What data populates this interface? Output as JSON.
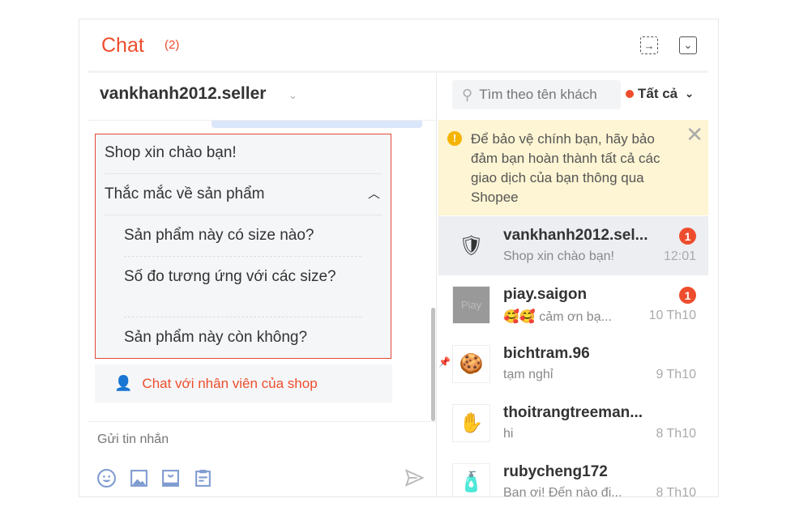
{
  "header": {
    "title": "Chat",
    "count": "(2)",
    "icons": [
      "exit-icon",
      "collapse-icon"
    ]
  },
  "conversation": {
    "username": "vankhanh2012.seller",
    "quick_replies": {
      "greeting": "Shop xin chào bạn!",
      "category": "Thắc mắc về sản phẩm",
      "questions": [
        "Sản phẩm này có size nào?",
        "Số đo tương ứng với các size?",
        "Sản phẩm này còn không?"
      ]
    },
    "staff_button": "Chat với nhân viên của shop",
    "input_placeholder": "Gửi tin nhắn",
    "toolbar": [
      "emoji-icon",
      "image-icon",
      "product-icon",
      "order-icon"
    ]
  },
  "sidebar": {
    "search_placeholder": "Tìm theo tên khách",
    "filter": "Tất cả",
    "filter_color": "#ee4d2d",
    "warning": "Để bảo vệ chính bạn, hãy bảo đảm bạn hoàn thành tất cả các giao dịch của bạn thông qua Shopee",
    "conversations": [
      {
        "name": "vankhanh2012.sel...",
        "message": "Shop xin chào bạn!",
        "time": "12:01",
        "unread": "1",
        "avatar": "🛡",
        "active": true
      },
      {
        "name": "piay.saigon",
        "message": "🥰🥰 cảm ơn bạ...",
        "time": "10 Th10",
        "unread": "1",
        "avatar": "Piay"
      },
      {
        "name": "bichtram.96",
        "message": "tạm nghỉ",
        "time": "9 Th10",
        "avatar": "🍪",
        "pinned": true
      },
      {
        "name": "thoitrangtreeman...",
        "message": "hi",
        "time": "8 Th10",
        "avatar": "✋"
      },
      {
        "name": "rubycheng172",
        "message": "Bạn ơi! Đến nào đi...",
        "time": "8 Th10",
        "avatar": "🧴"
      }
    ]
  },
  "accent": "#ee4d2d"
}
